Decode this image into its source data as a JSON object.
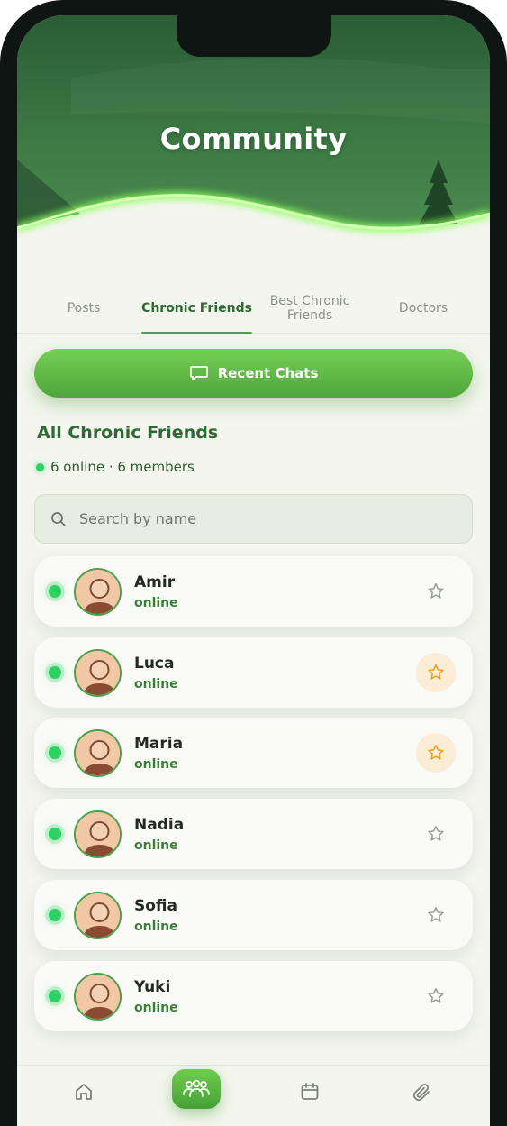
{
  "header": {
    "title": "Community"
  },
  "tabs": [
    {
      "label": "Posts",
      "active": false
    },
    {
      "label": "Chronic Friends",
      "active": true
    },
    {
      "label": "Best Chronic Friends",
      "active": false
    },
    {
      "label": "Doctors",
      "active": false
    }
  ],
  "recent_chats": {
    "label": "Recent Chats",
    "icon": "chat-bubble-icon"
  },
  "section": {
    "title": "All Chronic Friends",
    "summary": "6 online · 6 members"
  },
  "search": {
    "placeholder": "Search by name",
    "value": "",
    "icon": "search-icon"
  },
  "friends": [
    {
      "name": "Amir",
      "status": "online",
      "favorite": false
    },
    {
      "name": "Luca",
      "status": "online",
      "favorite": true
    },
    {
      "name": "Maria",
      "status": "online",
      "favorite": true
    },
    {
      "name": "Nadia",
      "status": "online",
      "favorite": false
    },
    {
      "name": "Sofia",
      "status": "online",
      "favorite": false
    },
    {
      "name": "Yuki",
      "status": "online",
      "favorite": false
    }
  ],
  "bottom_nav": [
    {
      "icon": "home-icon",
      "active": false
    },
    {
      "icon": "community-icon",
      "active": true
    },
    {
      "icon": "calendar-icon",
      "active": false
    },
    {
      "icon": "paperclip-icon",
      "active": false
    }
  ],
  "colors": {
    "brand_green": "#4ea53a",
    "dark_green": "#2f6a34",
    "online": "#2fcf63",
    "favorite_star": "#e8a22e",
    "background": "#f3f5ee"
  }
}
